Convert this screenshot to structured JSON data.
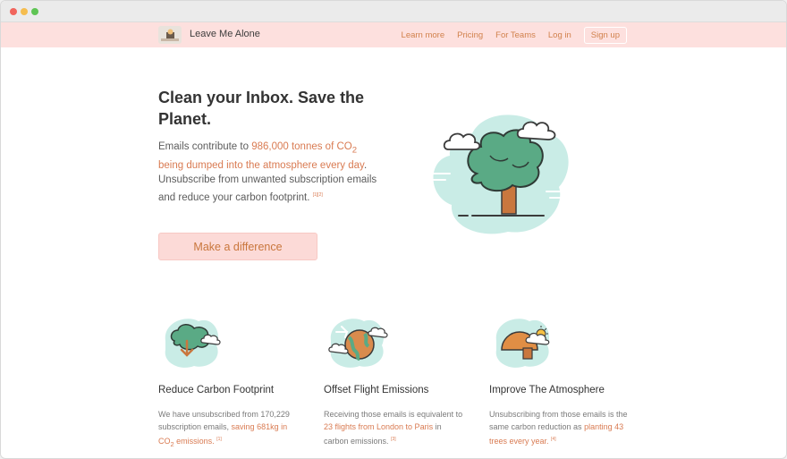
{
  "app": {
    "name": "Leave Me Alone"
  },
  "nav": {
    "links": [
      "Learn more",
      "Pricing",
      "For Teams",
      "Log in"
    ],
    "signup": "Sign up"
  },
  "hero": {
    "title": "Clean your Inbox. Save the Planet.",
    "text_prefix": "Emails contribute to ",
    "text_highlight_1": "986,000 tonnes of CO",
    "text_highlight_sub": "2",
    "text_highlight_2": " being dumped into the atmosphere every day",
    "text_suffix": ". Unsubscribe from unwanted subscription emails and reduce your carbon footprint.",
    "citation": "[1][2]",
    "cta": "Make a difference"
  },
  "features": [
    {
      "icon": "tree-download-icon",
      "title": "Reduce Carbon Footprint",
      "text_prefix": "We have unsubscribed from 170,229 subscription emails, ",
      "text_highlight": "saving 681kg in CO",
      "text_highlight_sub": "2",
      "text_highlight_suffix": " emissions.",
      "citation": "[1]"
    },
    {
      "icon": "globe-plane-icon",
      "title": "Offset Flight Emissions",
      "text_prefix": "Receiving those emails is equivalent to ",
      "text_highlight": "23 flights from London to Paris",
      "text_suffix": " in carbon emissions.",
      "citation": "[3]"
    },
    {
      "icon": "weather-sun-icon",
      "title": "Improve The Atmosphere",
      "text_prefix": "Unsubscribing from those emails is the same carbon reduction as ",
      "text_highlight": "planting 43 trees every year.",
      "citation": "[4]"
    }
  ]
}
